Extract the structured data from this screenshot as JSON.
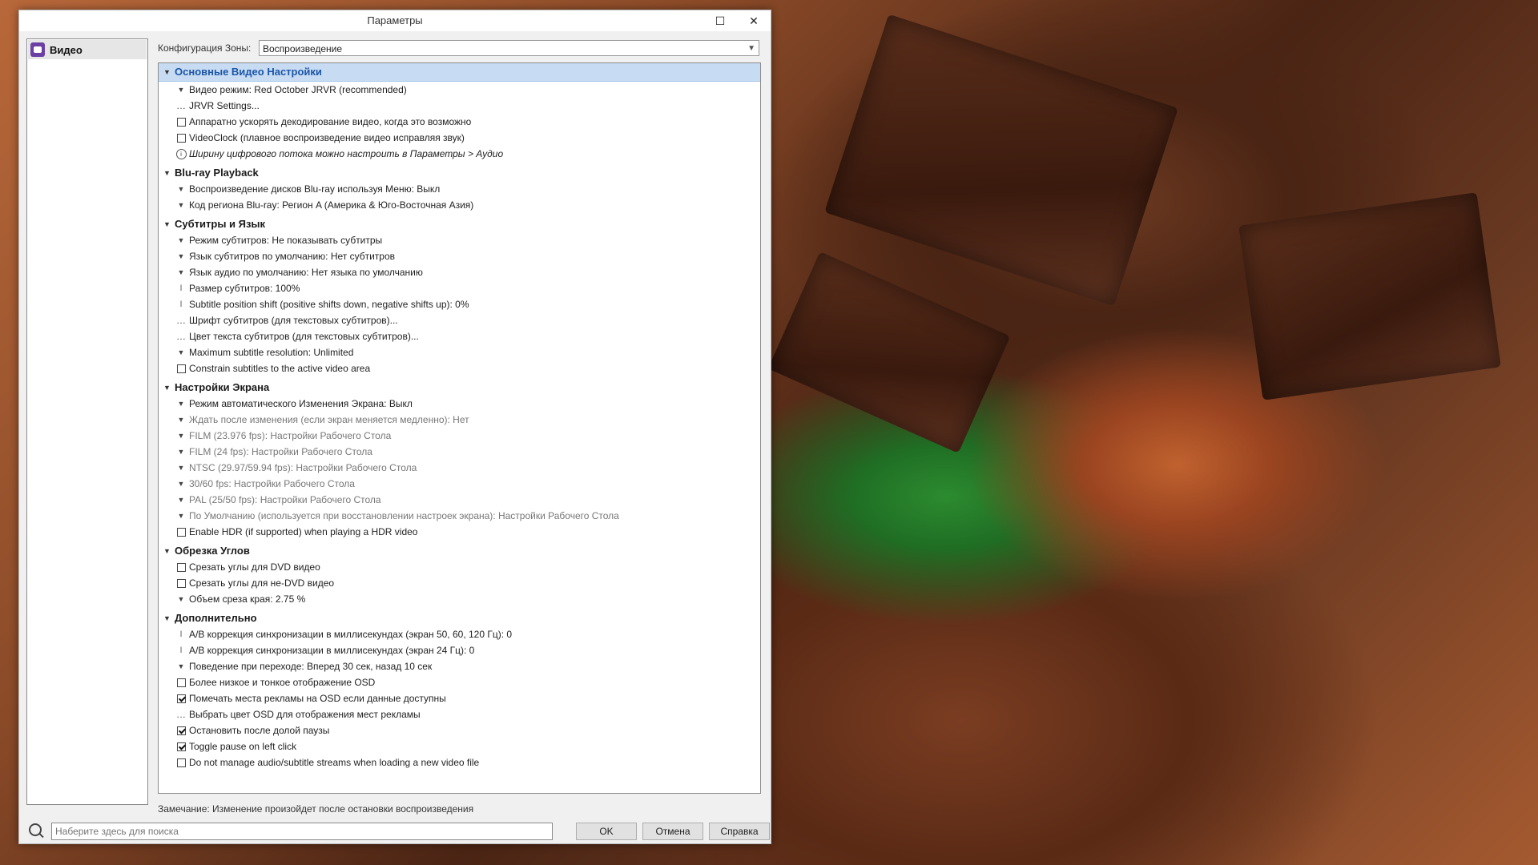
{
  "window": {
    "title": "Параметры",
    "maximize_icon": "maximize-icon",
    "close_icon": "close-icon"
  },
  "sidebar": {
    "items": [
      {
        "label": "Видео",
        "icon": "video-icon"
      }
    ]
  },
  "zone": {
    "label": "Конфигурация Зоны:",
    "value": "Воспроизведение"
  },
  "sections": [
    {
      "title": "Основные Видео Настройки",
      "selected": true,
      "rows": [
        {
          "type": "dropdown",
          "text": "Видео режим: Red October JRVR (recommended)"
        },
        {
          "type": "dots",
          "text": "JRVR Settings..."
        },
        {
          "type": "checkbox",
          "checked": false,
          "text": "Аппаратно ускорять декодирование видео, когда это возможно"
        },
        {
          "type": "checkbox",
          "checked": false,
          "text": "VideoClock (плавное воспроизведение видео исправляя звук)"
        },
        {
          "type": "info",
          "italic": true,
          "text": "Ширину цифрового потока можно настроить в Параметры > Аудио"
        }
      ]
    },
    {
      "title": "Blu-ray Playback",
      "rows": [
        {
          "type": "dropdown",
          "text": "Воспроизведение дисков Blu-ray используя Меню: Выкл"
        },
        {
          "type": "dropdown",
          "text": "Код региона Blu-ray: Регион A (Америка & Юго-Восточная Азия)"
        }
      ]
    },
    {
      "title": "Субтитры и Язык",
      "rows": [
        {
          "type": "dropdown",
          "text": "Режим субтитров: Не показывать субтитры"
        },
        {
          "type": "dropdown",
          "text": "Язык субтитров по умолчанию: Нет субтитров"
        },
        {
          "type": "dropdown",
          "text": "Язык аудио по умолчанию: Нет языка по умолчанию"
        },
        {
          "type": "edit",
          "text": "Размер субтитров: 100%"
        },
        {
          "type": "edit",
          "text": "Subtitle position shift (positive shifts down, negative shifts up): 0%"
        },
        {
          "type": "dots",
          "text": "Шрифт субтитров (для текстовых субтитров)..."
        },
        {
          "type": "dots",
          "text": "Цвет текста субтитров (для текстовых субтитров)..."
        },
        {
          "type": "dropdown",
          "text": "Maximum subtitle resolution: Unlimited"
        },
        {
          "type": "checkbox",
          "checked": false,
          "text": "Constrain subtitles to the active video area"
        }
      ]
    },
    {
      "title": "Настройки Экрана",
      "rows": [
        {
          "type": "dropdown",
          "text": "Режим автоматического Изменения Экрана: Выкл"
        },
        {
          "type": "dropdown",
          "dim": true,
          "text": "Ждать после изменения (если экран меняется медленно): Нет"
        },
        {
          "type": "dropdown",
          "dim": true,
          "text": "FILM (23.976 fps): Настройки Рабочего Стола"
        },
        {
          "type": "dropdown",
          "dim": true,
          "text": "FILM (24 fps): Настройки Рабочего Стола"
        },
        {
          "type": "dropdown",
          "dim": true,
          "text": "NTSC (29.97/59.94 fps): Настройки Рабочего Стола"
        },
        {
          "type": "dropdown",
          "dim": true,
          "text": "30/60 fps: Настройки Рабочего Стола"
        },
        {
          "type": "dropdown",
          "dim": true,
          "text": "PAL (25/50 fps): Настройки Рабочего Стола"
        },
        {
          "type": "dropdown",
          "dim": true,
          "text": "По Умолчанию (используется при восстановлении настроек экрана): Настройки Рабочего Стола"
        },
        {
          "type": "checkbox",
          "checked": false,
          "text": "Enable HDR (if supported) when playing a HDR video"
        }
      ]
    },
    {
      "title": "Обрезка Углов",
      "rows": [
        {
          "type": "checkbox",
          "checked": false,
          "text": "Срезать углы для DVD видео"
        },
        {
          "type": "checkbox",
          "checked": false,
          "text": "Срезать углы для не-DVD видео"
        },
        {
          "type": "dropdown",
          "text": "Объем среза края: 2.75 %"
        }
      ]
    },
    {
      "title": "Дополнительно",
      "rows": [
        {
          "type": "edit",
          "text": "A/B коррекция синхронизации в миллисекундах (экран 50, 60, 120 Гц): 0"
        },
        {
          "type": "edit",
          "text": "A/B коррекция синхронизации в миллисекундах (экран 24 Гц): 0"
        },
        {
          "type": "dropdown",
          "text": "Поведение при переходе: Вперед 30 сек, назад 10 сек"
        },
        {
          "type": "checkbox",
          "checked": false,
          "text": "Более низкое и тонкое отображение OSD"
        },
        {
          "type": "checkbox",
          "checked": true,
          "text": "Помечать места рекламы на OSD если данные доступны"
        },
        {
          "type": "dots",
          "text": "Выбрать цвет OSD для отображения мест рекламы"
        },
        {
          "type": "checkbox",
          "checked": true,
          "text": "Остановить после долой паузы"
        },
        {
          "type": "checkbox",
          "checked": true,
          "text": "Toggle pause on left click"
        },
        {
          "type": "checkbox",
          "checked": false,
          "text": "Do not manage audio/subtitle streams when loading a new video file"
        }
      ]
    }
  ],
  "note": "Замечание: Изменение произойдет после остановки воспроизведения",
  "search": {
    "placeholder": "Наберите здесь для поиска",
    "icon": "search-icon"
  },
  "buttons": {
    "ok": "OK",
    "cancel": "Отмена",
    "help": "Справка"
  }
}
